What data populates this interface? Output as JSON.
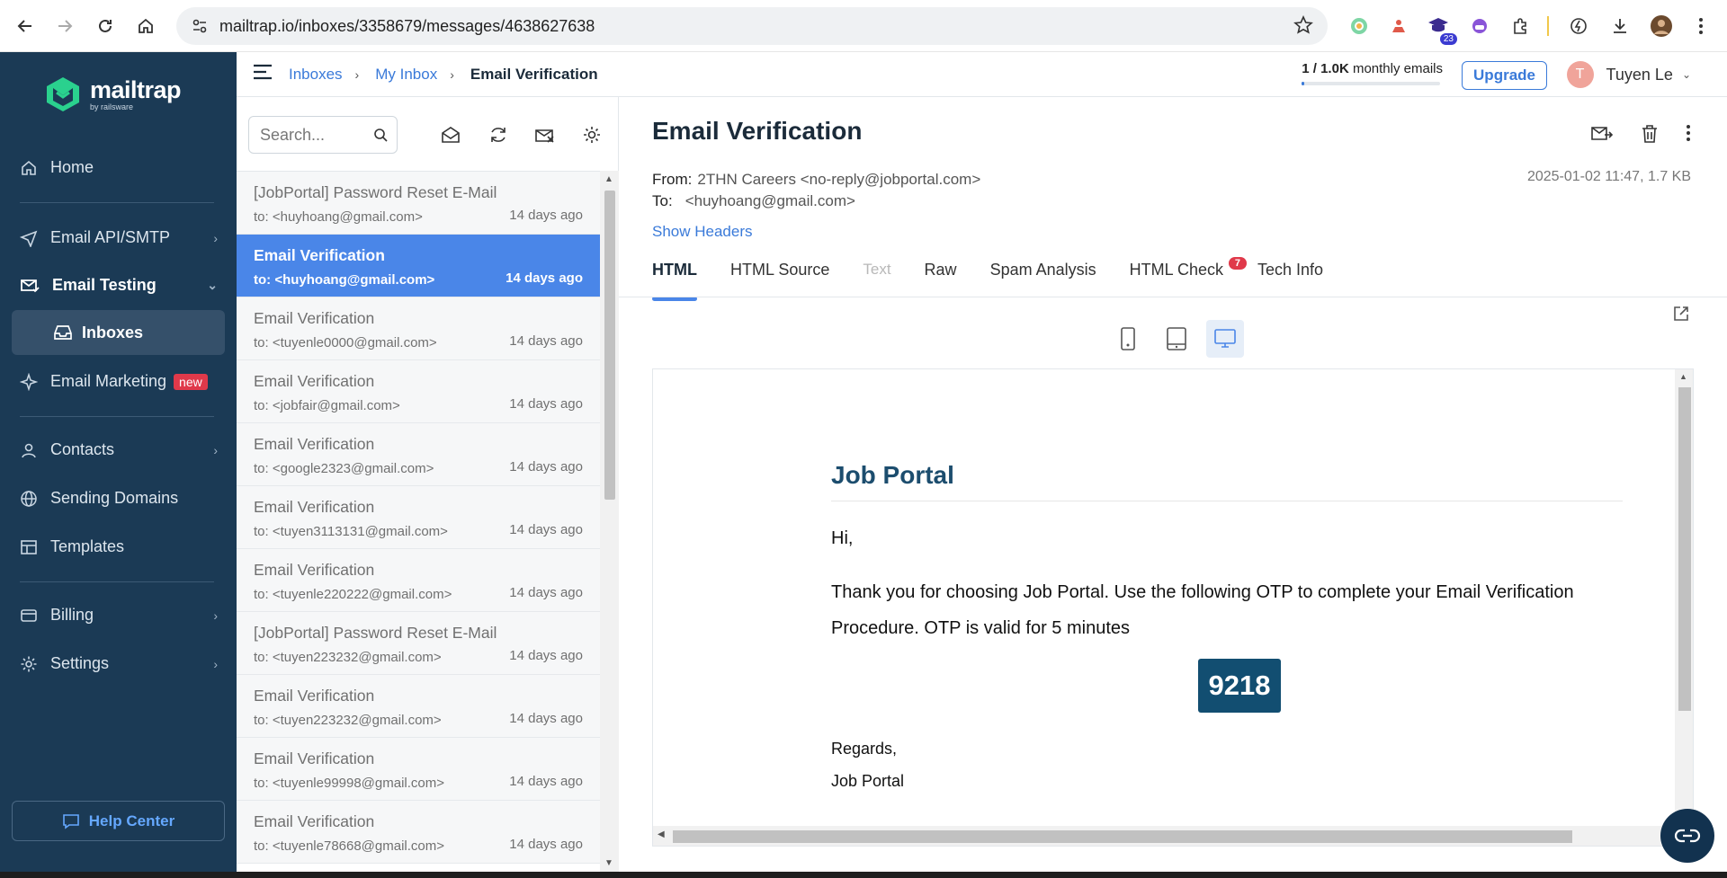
{
  "browser": {
    "url": "mailtrap.io/inboxes/3358679/messages/4638627638",
    "ext_badge": "23"
  },
  "sidebar": {
    "logo_name": "mailtrap",
    "logo_sub": "by railsware",
    "items": [
      {
        "label": "Home"
      },
      {
        "label": "Email API/SMTP"
      },
      {
        "label": "Email Testing"
      },
      {
        "label": "Inboxes"
      },
      {
        "label": "Email Marketing",
        "badge": "new"
      },
      {
        "label": "Contacts"
      },
      {
        "label": "Sending Domains"
      },
      {
        "label": "Templates"
      },
      {
        "label": "Billing"
      },
      {
        "label": "Settings"
      }
    ],
    "help": "Help Center"
  },
  "topbar": {
    "breadcrumb": [
      "Inboxes",
      "My Inbox",
      "Email Verification"
    ],
    "quota_used": "1 / 1.0K",
    "quota_label": "monthly emails",
    "quota_fraction": 0.001,
    "upgrade": "Upgrade",
    "user_initial": "T",
    "user_name": "Tuyen Le"
  },
  "list": {
    "search_placeholder": "Search...",
    "messages": [
      {
        "subject": "[JobPortal] Password Reset E-Mail",
        "to": "to: <huyhoang@gmail.com>",
        "ago": "14 days ago"
      },
      {
        "subject": "Email Verification",
        "to": "to: <huyhoang@gmail.com>",
        "ago": "14 days ago",
        "selected": true
      },
      {
        "subject": "Email Verification",
        "to": "to: <tuyenle0000@gmail.com>",
        "ago": "14 days ago"
      },
      {
        "subject": "Email Verification",
        "to": "to: <jobfair@gmail.com>",
        "ago": "14 days ago"
      },
      {
        "subject": "Email Verification",
        "to": "to: <google2323@gmail.com>",
        "ago": "14 days ago"
      },
      {
        "subject": "Email Verification",
        "to": "to: <tuyen3113131@gmail.com>",
        "ago": "14 days ago"
      },
      {
        "subject": "Email Verification",
        "to": "to: <tuyenle220222@gmail.com>",
        "ago": "14 days ago"
      },
      {
        "subject": "[JobPortal] Password Reset E-Mail",
        "to": "to: <tuyen223232@gmail.com>",
        "ago": "14 days ago"
      },
      {
        "subject": "Email Verification",
        "to": "to: <tuyen223232@gmail.com>",
        "ago": "14 days ago"
      },
      {
        "subject": "Email Verification",
        "to": "to: <tuyenle99998@gmail.com>",
        "ago": "14 days ago"
      },
      {
        "subject": "Email Verification",
        "to": "to: <tuyenle78668@gmail.com>",
        "ago": "14 days ago"
      }
    ]
  },
  "message": {
    "title": "Email Verification",
    "from_label": "From:",
    "from": "2THN Careers <no-reply@jobportal.com>",
    "to_label": "To:",
    "to": "<huyhoang@gmail.com>",
    "date_size": "2025-01-02 11:47, 1.7 KB",
    "show_headers": "Show Headers",
    "tabs": [
      {
        "label": "HTML"
      },
      {
        "label": "HTML Source"
      },
      {
        "label": "Text"
      },
      {
        "label": "Raw"
      },
      {
        "label": "Spam Analysis"
      },
      {
        "label": "HTML Check",
        "count": "7"
      },
      {
        "label": "Tech Info"
      }
    ]
  },
  "email": {
    "brand": "Job Portal",
    "greeting": "Hi,",
    "body": "Thank you for choosing Job Portal. Use the following OTP to complete your Email Verification Procedure. OTP is valid for 5 minutes",
    "otp": "9218",
    "regards": "Regards,",
    "signature": "Job Portal"
  }
}
